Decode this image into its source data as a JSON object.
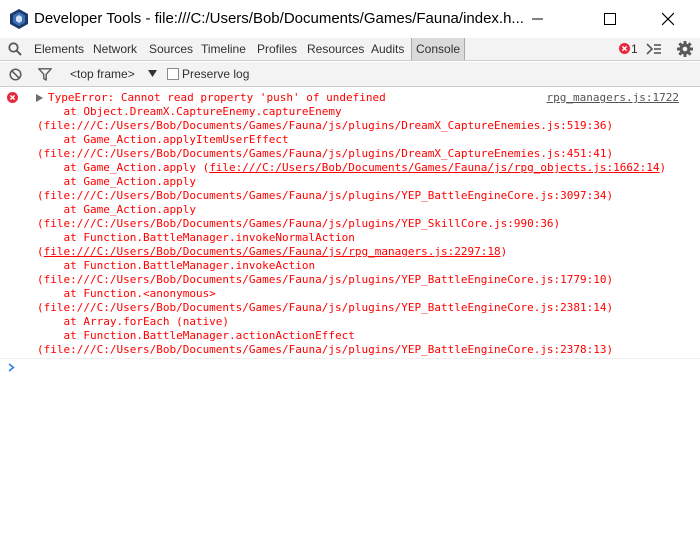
{
  "window": {
    "title": "Developer Tools - file:///C:/Users/Bob/Documents/Games/Fauna/index.h..."
  },
  "tabs": [
    {
      "label": "Elements"
    },
    {
      "label": "Network"
    },
    {
      "label": "Sources"
    },
    {
      "label": "Timeline"
    },
    {
      "label": "Profiles"
    },
    {
      "label": "Resources"
    },
    {
      "label": "Audits"
    },
    {
      "label": "Console",
      "active": true
    }
  ],
  "status": {
    "error_count": "1"
  },
  "toolbar": {
    "frame_select": "<top frame>",
    "preserve_log_label": "Preserve log",
    "preserve_log_checked": false
  },
  "console": {
    "source_link": "rpg_managers.js:1722",
    "lines": [
      "TypeError: Cannot read property 'push' of undefined",
      "    at Object.DreamX.CaptureEnemy.captureEnemy",
      "(file:///C:/Users/Bob/Documents/Games/Fauna/js/plugins/DreamX_CaptureEnemies.js:519:36)",
      "    at Game_Action.applyItemUserEffect",
      "(file:///C:/Users/Bob/Documents/Games/Fauna/js/plugins/DreamX_CaptureEnemies.js:451:41)",
      "    at Game_Action.apply (",
      "file:///C:/Users/Bob/Documents/Games/Fauna/js/rpg_objects.js:1662:14",
      ")",
      "    at Game_Action.apply",
      "(file:///C:/Users/Bob/Documents/Games/Fauna/js/plugins/YEP_BattleEngineCore.js:3097:34)",
      "    at Game_Action.apply",
      "(file:///C:/Users/Bob/Documents/Games/Fauna/js/plugins/YEP_SkillCore.js:990:36)",
      "    at Function.BattleManager.invokeNormalAction",
      "(",
      "file:///C:/Users/Bob/Documents/Games/Fauna/js/rpg_managers.js:2297:18",
      ")",
      "    at Function.BattleManager.invokeAction",
      "(file:///C:/Users/Bob/Documents/Games/Fauna/js/plugins/YEP_BattleEngineCore.js:1779:10)",
      "    at Function.<anonymous>",
      "(file:///C:/Users/Bob/Documents/Games/Fauna/js/plugins/YEP_BattleEngineCore.js:2381:14)",
      "    at Array.forEach (native)",
      "    at Function.BattleManager.actionActionEffect",
      "(file:///C:/Users/Bob/Documents/Games/Fauna/js/plugins/YEP_BattleEngineCore.js:2378:13)"
    ]
  },
  "colors": {
    "error": "#ff0000",
    "toolbar_bg": "#f3f3f3",
    "error_icon": "#e8283c"
  },
  "icons": [
    "app-icon",
    "minimize-icon",
    "maximize-icon",
    "close-icon",
    "search-icon",
    "error-icon",
    "drawer-icon",
    "gear-icon",
    "clear-icon",
    "filter-icon",
    "chevron-down-icon",
    "expand-triangle-icon",
    "prompt-chevron-icon"
  ]
}
